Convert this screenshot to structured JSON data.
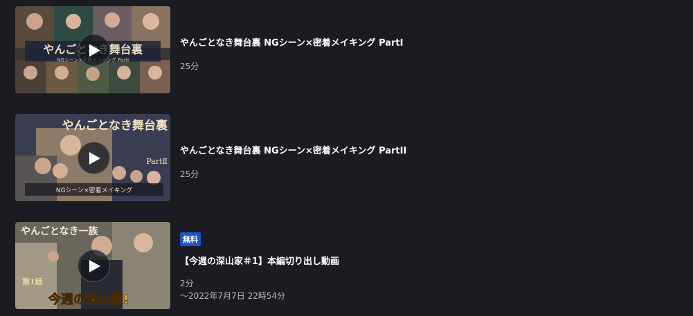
{
  "episodes": [
    {
      "thumb_text": "やんごとなき舞台裏",
      "thumb_sub": "NGシーン×密着メイキング PartⅠ",
      "title": "やんごとなき舞台裏 NGシーン×密着メイキング PartI",
      "duration": "25分"
    },
    {
      "thumb_text": "やんごとなき舞台裏",
      "thumb_part": "PartⅡ",
      "thumb_sub": "NGシーン×密着メイキング",
      "title": "やんごとなき舞台裏 NGシーン×密着メイキング PartII",
      "duration": "25分"
    },
    {
      "thumb_text": "やんごとなき一族",
      "thumb_episode": "第1話",
      "thumb_caption": "今週の深山家!",
      "badge": "無料",
      "title": "【今週の深山家＃1】本編切り出し動画",
      "duration": "2分",
      "available_until": "〜2022年7月7日 22時54分"
    }
  ],
  "colors": {
    "background": "#1b1c21",
    "badge": "#1e53c9",
    "meta": "#b9bac0"
  }
}
